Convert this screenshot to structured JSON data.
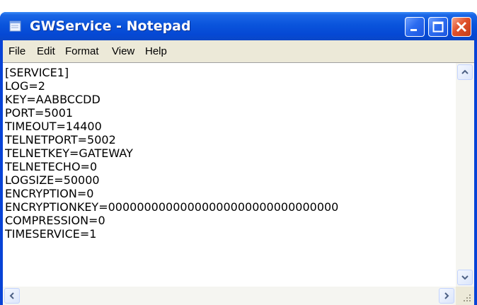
{
  "window": {
    "title": "GWService - Notepad",
    "app_icon": "notepad-icon"
  },
  "title_buttons": {
    "minimize": "minimize-icon",
    "maximize": "maximize-icon",
    "close": "close-icon"
  },
  "menu": {
    "items": [
      "File",
      "Edit",
      "Format",
      "View",
      "Help"
    ]
  },
  "document": {
    "lines": [
      "[SERVICE1]",
      "LOG=2",
      "KEY=AABBCCDD",
      "PORT=5001",
      "TIMEOUT=14400",
      "TELNETPORT=5002",
      "TELNETKEY=GATEWAY",
      "TELNETECHO=0",
      "LOGSIZE=50000",
      "ENCRYPTION=0",
      "ENCRYPTIONKEY=00000000000000000000000000000000",
      "COMPRESSION=0",
      "TIMESERVICE=1"
    ]
  },
  "colors": {
    "titlebar": "#0a54dc",
    "close_button": "#e0502a",
    "menubar": "#ece9d8"
  }
}
